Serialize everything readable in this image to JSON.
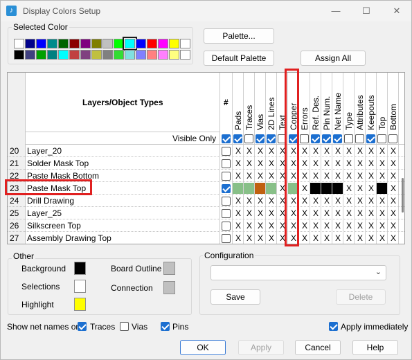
{
  "window": {
    "title": "Display Colors Setup",
    "app_icon": "music-note-icon",
    "minimize": "—",
    "maximize": "☐",
    "close": "✕"
  },
  "selected_color": {
    "label": "Selected Color",
    "palette_row1": [
      "#ffffff",
      "#00008b",
      "#0000ff",
      "#008b8b",
      "#006400",
      "#8b0000",
      "#800080",
      "#808000",
      "#c0c0c0",
      "#00ff00",
      "#00ffff",
      "#0000ff",
      "#ff0000",
      "#ff00ff",
      "#ffff00",
      "#ffffff"
    ],
    "palette_row2": [
      "#000000",
      "#404080",
      "#00a000",
      "#008080",
      "#00ffff",
      "#c04040",
      "#804080",
      "#c0c040",
      "#808080",
      "#33dd33",
      "#80e0e0",
      "#8080ff",
      "#ff8080",
      "#ff80ff",
      "#ffff80",
      "#ffffff"
    ],
    "selected_swatch_color": "#00ff00"
  },
  "buttons": {
    "palette": "Palette...",
    "default_palette": "Default Palette",
    "assign_all": "Assign All",
    "ok": "OK",
    "apply": "Apply",
    "cancel": "Cancel",
    "help": "Help",
    "save": "Save",
    "delete": "Delete"
  },
  "grid": {
    "header_title": "Layers/Object Types",
    "hash_header": "#",
    "columns": [
      "Pads",
      "Traces",
      "Vias",
      "2D Lines",
      "Text",
      "Copper",
      "Errors",
      "Ref. Des.",
      "Pin Num.",
      "Net Name",
      "Type",
      "Attributes",
      "Keepouts",
      "Top",
      "Bottom"
    ],
    "visible_only_label": "Visible Only",
    "visible_only_checks": [
      true,
      true,
      false,
      true,
      true,
      false,
      true,
      false,
      true,
      true,
      true,
      false,
      false,
      true,
      false,
      false
    ],
    "rows": [
      {
        "num": "20",
        "name": "Layer_20",
        "visible": false,
        "cells": [
          "X",
          "X",
          "X",
          "X",
          "X",
          "X",
          "X",
          "X",
          "X",
          "X",
          "X",
          "X",
          "X",
          "X",
          "X"
        ]
      },
      {
        "num": "21",
        "name": "Solder Mask Top",
        "visible": false,
        "cells": [
          "X",
          "X",
          "X",
          "X",
          "X",
          "X",
          "X",
          "X",
          "X",
          "X",
          "X",
          "X",
          "X",
          "X",
          "X"
        ]
      },
      {
        "num": "22",
        "name": "Paste Mask Bottom",
        "visible": false,
        "cells": [
          "X",
          "X",
          "X",
          "X",
          "X",
          "X",
          "X",
          "X",
          "X",
          "X",
          "X",
          "X",
          "X",
          "X",
          "X"
        ]
      },
      {
        "num": "23",
        "name": "Paste Mask Top",
        "visible": true,
        "cells": [
          "#88c088",
          "#88c088",
          "#c06010",
          "#88c088",
          "X",
          "#88c088",
          "X",
          "#000000",
          "#000000",
          "#000000",
          "X",
          "X",
          "X",
          "#000000",
          "X"
        ]
      },
      {
        "num": "24",
        "name": "Drill Drawing",
        "visible": false,
        "cells": [
          "X",
          "X",
          "X",
          "X",
          "X",
          "X",
          "X",
          "X",
          "X",
          "X",
          "X",
          "X",
          "X",
          "X",
          "X"
        ]
      },
      {
        "num": "25",
        "name": "Layer_25",
        "visible": false,
        "cells": [
          "X",
          "X",
          "X",
          "X",
          "X",
          "X",
          "X",
          "X",
          "X",
          "X",
          "X",
          "X",
          "X",
          "X",
          "X"
        ]
      },
      {
        "num": "26",
        "name": "Silkscreen Top",
        "visible": false,
        "cells": [
          "X",
          "X",
          "X",
          "X",
          "X",
          "X",
          "X",
          "X",
          "X",
          "X",
          "X",
          "X",
          "X",
          "X",
          "X"
        ]
      },
      {
        "num": "27",
        "name": "Assembly Drawing Top",
        "visible": false,
        "cells": [
          "X",
          "X",
          "X",
          "X",
          "X",
          "X",
          "X",
          "X",
          "X",
          "X",
          "X",
          "X",
          "X",
          "X",
          "X"
        ]
      }
    ]
  },
  "other": {
    "label": "Other",
    "background": {
      "label": "Background",
      "color": "#000000"
    },
    "board_outline": {
      "label": "Board Outline",
      "color": "#c0c0c0"
    },
    "selections": {
      "label": "Selections",
      "color": "#ffffff"
    },
    "connection": {
      "label": "Connection",
      "color": "#c0c0c0"
    },
    "highlight": {
      "label": "Highlight",
      "color": "#ffff00"
    }
  },
  "configuration": {
    "label": "Configuration",
    "value": ""
  },
  "show_net_names": {
    "label": "Show net names on",
    "traces": "Traces",
    "vias": "Vias",
    "pins": "Pins",
    "traces_checked": true,
    "vias_checked": false,
    "pins_checked": true
  },
  "apply_immediately": {
    "label": "Apply immediately",
    "checked": true
  }
}
